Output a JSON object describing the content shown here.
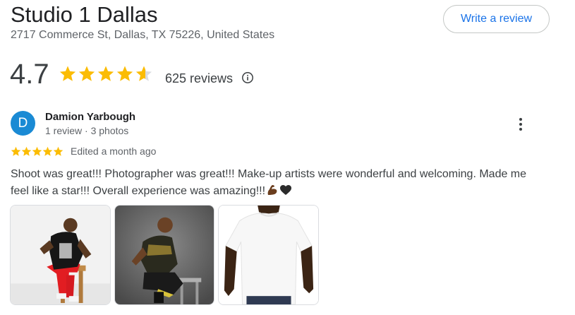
{
  "place": {
    "name": "Studio 1 Dallas",
    "address": "2717 Commerce St, Dallas, TX 75226, United States"
  },
  "actions": {
    "write_review_label": "Write a review"
  },
  "summary": {
    "rating": "4.7",
    "rating_value": 4.7,
    "review_count_label": "625 reviews",
    "info_icon": "info-icon"
  },
  "review": {
    "avatar_letter": "D",
    "avatar_color": "#1a8ad4",
    "author": "Damion Yarbough",
    "meta": "1 review · 3 photos",
    "stars": 5,
    "edited": "Edited a month ago",
    "text": "Shoot was great!!! Photographer was great!!! Make-up artists were wonderful and welcoming. Made me feel like a star!!! Overall experience was amazing!!!",
    "emojis": [
      "flexed-biceps-icon",
      "black-heart-icon"
    ],
    "more_icon": "more-vertical-icon",
    "photos": [
      "review-photo-1",
      "review-photo-2",
      "review-photo-3"
    ]
  },
  "colors": {
    "star": "#fbbc04",
    "star_empty": "#dadce0",
    "accent": "#1a73e8"
  }
}
